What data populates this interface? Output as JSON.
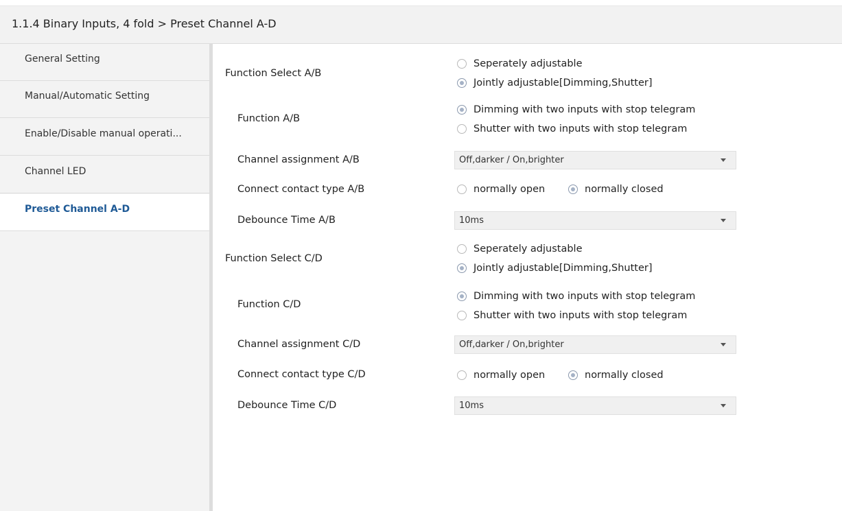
{
  "header": {
    "title": "1.1.4 Binary Inputs, 4 fold > Preset Channel A-D"
  },
  "sidebar": {
    "items": [
      {
        "label": "General Setting",
        "active": false
      },
      {
        "label": "Manual/Automatic Setting",
        "active": false
      },
      {
        "label": "Enable/Disable manual operati...",
        "active": false
      },
      {
        "label": "Channel LED",
        "active": false
      },
      {
        "label": "Preset Channel A-D",
        "active": true
      }
    ]
  },
  "ab": {
    "function_select": {
      "label": "Function Select A/B",
      "options": [
        "Seperately adjustable",
        "Jointly adjustable[Dimming,Shutter]"
      ],
      "selected": 1
    },
    "function": {
      "label": "Function A/B",
      "options": [
        "Dimming with two inputs with stop telegram",
        "Shutter with two inputs with stop telegram"
      ],
      "selected": 0
    },
    "channel_assignment": {
      "label": "Channel assignment A/B",
      "value": "Off,darker / On,brighter"
    },
    "contact_type": {
      "label": "Connect contact type A/B",
      "options": [
        "normally open",
        "normally closed"
      ],
      "selected": 1
    },
    "debounce": {
      "label": "Debounce Time A/B",
      "value": "10ms"
    }
  },
  "cd": {
    "function_select": {
      "label": "Function Select C/D",
      "options": [
        "Seperately adjustable",
        "Jointly adjustable[Dimming,Shutter]"
      ],
      "selected": 1
    },
    "function": {
      "label": "Function C/D",
      "options": [
        "Dimming with two inputs with stop telegram",
        "Shutter with two inputs with stop telegram"
      ],
      "selected": 0
    },
    "channel_assignment": {
      "label": "Channel assignment C/D",
      "value": "Off,darker / On,brighter"
    },
    "contact_type": {
      "label": "Connect contact type C/D",
      "options": [
        "normally open",
        "normally closed"
      ],
      "selected": 1
    },
    "debounce": {
      "label": "Debounce Time C/D",
      "value": "10ms"
    }
  },
  "colors": {
    "active_nav": "#1f5a96",
    "sidebar_bg": "#f3f3f3",
    "header_bg": "#f2f2f2"
  }
}
